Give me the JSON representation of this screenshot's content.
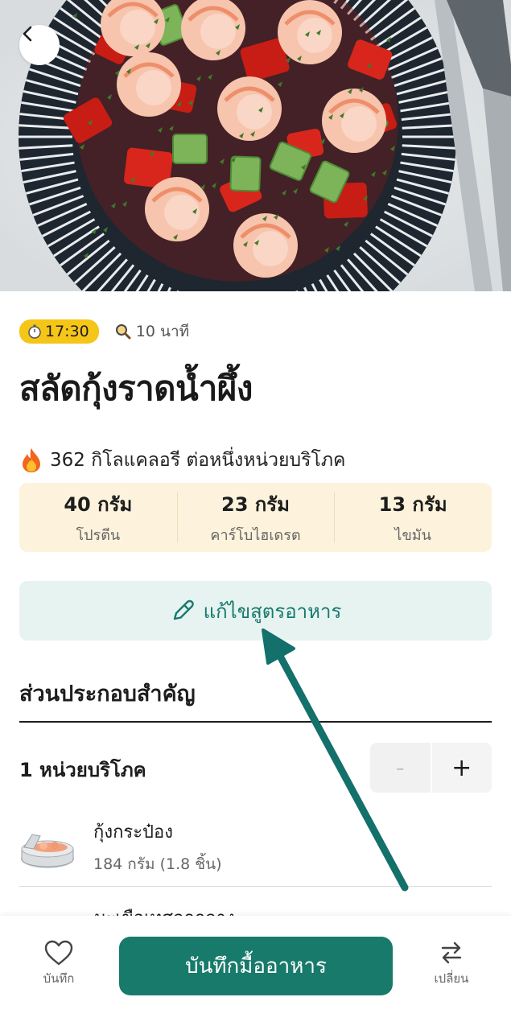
{
  "recipe": {
    "time_badge": "17:30",
    "duration": "10 นาที",
    "title": "สลัดกุ้งราดน้ำผึ้ง",
    "calories_text": "362 กิโลแคลอรี ต่อหนึ่งหน่วยบริโภค",
    "macros": [
      {
        "value": "40 กรัม",
        "label": "โปรตีน"
      },
      {
        "value": "23 กรัม",
        "label": "คาร์โบไฮเดรต"
      },
      {
        "value": "13 กรัม",
        "label": "ไขมัน"
      }
    ],
    "edit_label": "แก้ไขสูตรอาหาร"
  },
  "ingredients": {
    "section_title": "ส่วนประกอบสำคัญ",
    "serving_label": "1 หน่วยบริโภค",
    "minus_label": "-",
    "plus_label": "+",
    "items": [
      {
        "name": "กุ้งกระป๋อง",
        "amount": "184 กรัม (1.8 ชิ้น)"
      },
      {
        "name": "มะเขือเทศลูกกลาง",
        "amount": ""
      }
    ]
  },
  "bottom_bar": {
    "favorite_label": "บันทึก",
    "save_meal_label": "บันทึกมื้ออาหาร",
    "swap_label": "เปลี่ยน"
  },
  "colors": {
    "accent_teal": "#177a6b",
    "badge_yellow": "#f5c518",
    "macro_bg": "#fdf3dc",
    "edit_bg": "#e6f3f1"
  },
  "icons": {
    "back": "chevron-left-icon",
    "timer": "stopwatch-icon",
    "duration": "magnifier-icon",
    "calories": "fire-icon",
    "edit": "pencil-icon",
    "favorite": "heart-icon",
    "swap": "swap-arrows-icon"
  }
}
